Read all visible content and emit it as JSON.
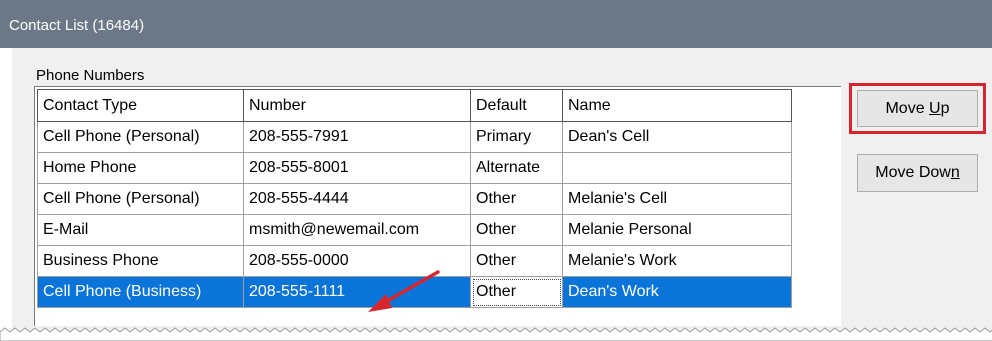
{
  "window": {
    "title": "Contact List (16484)"
  },
  "section": {
    "label": "Phone Numbers"
  },
  "table": {
    "headers": [
      "Contact Type",
      "Number",
      "Default",
      "Name"
    ],
    "rows": [
      [
        "Cell Phone (Personal)",
        "208-555-7991",
        "Primary",
        "Dean's Cell"
      ],
      [
        "Home Phone",
        "208-555-8001",
        "Alternate",
        ""
      ],
      [
        "Cell Phone (Personal)",
        "208-555-4444",
        "Other",
        "Melanie's Cell"
      ],
      [
        "E-Mail",
        "msmith@newemail.com",
        "Other",
        "Melanie Personal"
      ],
      [
        "Business Phone",
        "208-555-0000",
        "Other",
        "Melanie's Work"
      ],
      [
        "Cell Phone (Business)",
        "208-555-1111",
        "Other",
        "Dean's Work"
      ]
    ],
    "selected_row": 5
  },
  "buttons": {
    "move_up_pre": "Move ",
    "move_up_key": "U",
    "move_up_post": "p",
    "move_down_pre": "Move Dow",
    "move_down_key": "n",
    "move_down_post": ""
  },
  "colors": {
    "titlebar": "#6c7887",
    "selection": "#0a74d8",
    "callout": "#d6252c"
  },
  "icons": [
    "red-arrow-annotation-icon"
  ]
}
